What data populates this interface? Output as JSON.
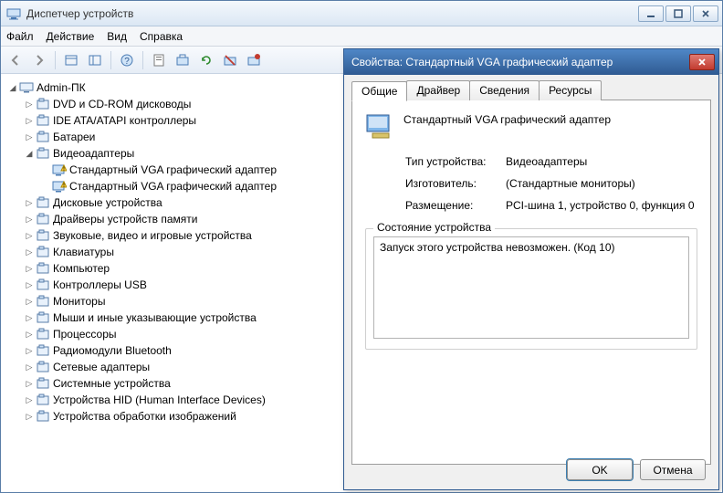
{
  "window": {
    "title": "Диспетчер устройств"
  },
  "menu": {
    "file": "Файл",
    "action": "Действие",
    "view": "Вид",
    "help": "Справка"
  },
  "tree": {
    "root": "Admin-ПК",
    "items": [
      {
        "label": "DVD и CD-ROM дисководы",
        "expanded": false
      },
      {
        "label": "IDE ATA/ATAPI контроллеры",
        "expanded": false
      },
      {
        "label": "Батареи",
        "expanded": false
      },
      {
        "label": "Видеоадаптеры",
        "expanded": true,
        "children": [
          {
            "label": "Стандартный VGA графический адаптер",
            "warn": true
          },
          {
            "label": "Стандартный VGA графический адаптер",
            "warn": true
          }
        ]
      },
      {
        "label": "Дисковые устройства",
        "expanded": false
      },
      {
        "label": "Драйверы устройств памяти",
        "expanded": false
      },
      {
        "label": "Звуковые, видео и игровые устройства",
        "expanded": false
      },
      {
        "label": "Клавиатуры",
        "expanded": false
      },
      {
        "label": "Компьютер",
        "expanded": false
      },
      {
        "label": "Контроллеры USB",
        "expanded": false
      },
      {
        "label": "Мониторы",
        "expanded": false
      },
      {
        "label": "Мыши и иные указывающие устройства",
        "expanded": false
      },
      {
        "label": "Процессоры",
        "expanded": false
      },
      {
        "label": "Радиомодули Bluetooth",
        "expanded": false
      },
      {
        "label": "Сетевые адаптеры",
        "expanded": false
      },
      {
        "label": "Системные устройства",
        "expanded": false
      },
      {
        "label": "Устройства HID (Human Interface Devices)",
        "expanded": false
      },
      {
        "label": "Устройства обработки изображений",
        "expanded": false
      }
    ]
  },
  "dialog": {
    "title": "Свойства: Стандартный VGA графический адаптер",
    "tabs": {
      "general": "Общие",
      "driver": "Драйвер",
      "details": "Сведения",
      "resources": "Ресурсы"
    },
    "device_name": "Стандартный VGA графический адаптер",
    "rows": {
      "type_label": "Тип устройства:",
      "type_value": "Видеоадаптеры",
      "mfr_label": "Изготовитель:",
      "mfr_value": "(Стандартные мониторы)",
      "loc_label": "Размещение:",
      "loc_value": "PCI-шина 1, устройство 0, функция 0"
    },
    "status_legend": "Состояние устройства",
    "status_text": "Запуск этого устройства невозможен. (Код 10)",
    "ok": "OK",
    "cancel": "Отмена"
  }
}
